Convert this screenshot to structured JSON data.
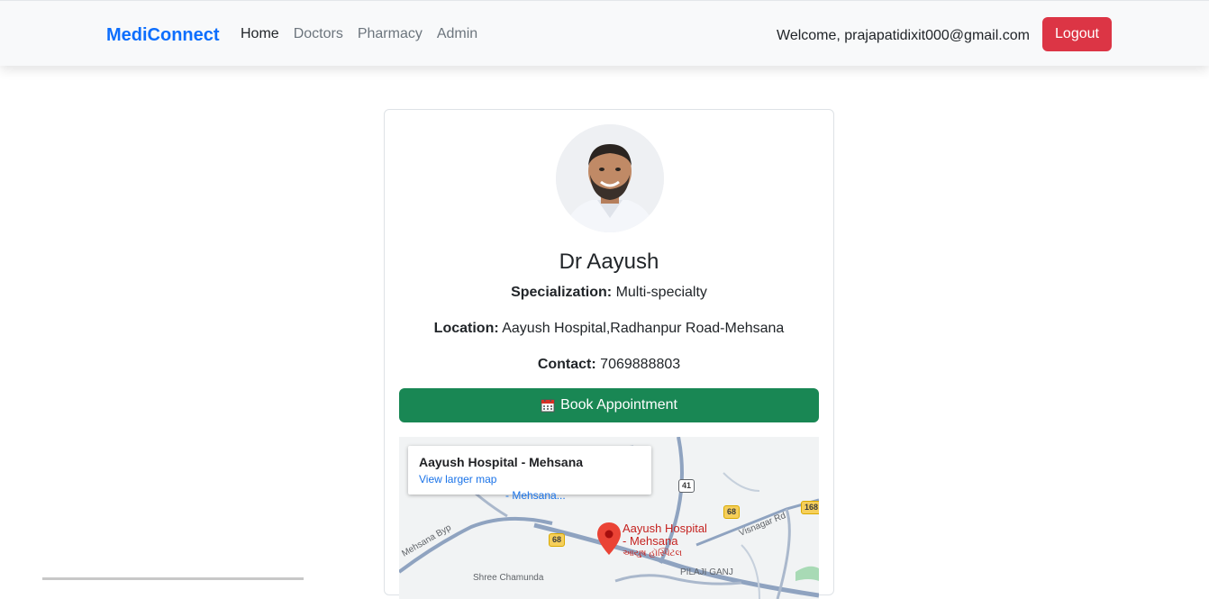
{
  "nav": {
    "brand": "MediConnect",
    "links": [
      "Home",
      "Doctors",
      "Pharmacy",
      "Admin"
    ],
    "welcome": "Welcome, prajapatidixit000@gmail.com",
    "logout_label": "Logout"
  },
  "doctor": {
    "name": "Dr Aayush",
    "specialization_label": "Specialization:",
    "specialization": "Multi-specialty",
    "location_label": "Location:",
    "location": "Aayush Hospital,Radhanpur Road-Mehsana",
    "contact_label": "Contact:",
    "contact": "7069888803"
  },
  "book_label": "Book Appointment",
  "map": {
    "card_title": "Aayush Hospital - Mehsana",
    "card_link": "View larger map",
    "place_label_1": "Aayush Hospital",
    "place_label_2": "- Mehsana",
    "place_label_3": "આયુષ હૉસ્પિટલ",
    "partial_label": "- Mehsana...",
    "road_labels": [
      "Mehsana Byp",
      "Visnagar Rd",
      "PILAJI GANJ",
      "Shree Chamunda"
    ],
    "shields": [
      "41",
      "68",
      "68",
      "168"
    ]
  },
  "colors": {
    "brand": "#0d6efd",
    "logout": "#dc3545",
    "book": "#198754"
  },
  "icons": {
    "calendar": "calendar-icon",
    "map_pin": "map-pin-icon"
  }
}
